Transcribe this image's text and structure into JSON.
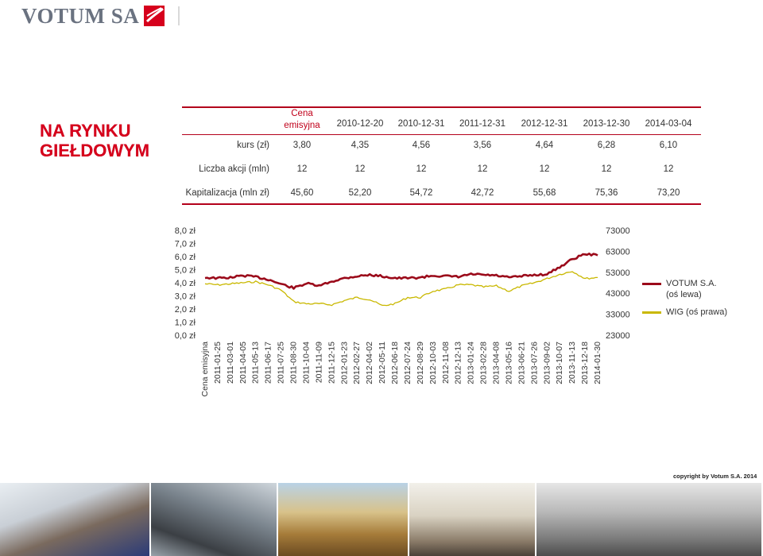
{
  "brand": {
    "name": "VOTUM SA"
  },
  "section_title": [
    "NA RYNKU",
    "GIEŁDOWYM"
  ],
  "table": {
    "first_header": "Cena emisyjna",
    "dates": [
      "2010-12-20",
      "2010-12-31",
      "2011-12-31",
      "2012-12-31",
      "2013-12-30",
      "2014-03-04"
    ],
    "rows": [
      {
        "label": "kurs (zł)",
        "values": [
          "3,80",
          "4,35",
          "4,56",
          "3,56",
          "4,64",
          "6,28",
          "6,10"
        ]
      },
      {
        "label": "Liczba akcji (mln)",
        "values": [
          "12",
          "12",
          "12",
          "12",
          "12",
          "12",
          "12"
        ]
      },
      {
        "label": "Kapitalizacja (mln zł)",
        "values": [
          "45,60",
          "52,20",
          "54,72",
          "42,72",
          "55,68",
          "75,36",
          "73,20"
        ]
      }
    ]
  },
  "chart_data": {
    "type": "line",
    "x_categories": [
      "Cena emisyjna",
      "2011-01-25",
      "2011-03-01",
      "2011-04-05",
      "2011-05-13",
      "2011-06-17",
      "2011-07-25",
      "2011-08-30",
      "2011-10-04",
      "2011-11-09",
      "2011-12-15",
      "2012-01-23",
      "2012-02-27",
      "2012-04-02",
      "2012-05-11",
      "2012-06-18",
      "2012-07-24",
      "2012-08-29",
      "2012-10-03",
      "2012-11-08",
      "2012-12-13",
      "2013-01-24",
      "2013-02-28",
      "2013-04-08",
      "2013-05-16",
      "2013-06-21",
      "2013-07-26",
      "2013-09-02",
      "2013-10-07",
      "2013-11-13",
      "2013-12-18",
      "2014-01-30"
    ],
    "y_left_ticks": [
      "8,0 zł",
      "7,0 zł",
      "6,0 zł",
      "5,0 zł",
      "4,0 zł",
      "3,0 zł",
      "2,0 zł",
      "1,0 zł",
      "0,0 zł"
    ],
    "y_left_range": [
      0,
      8
    ],
    "y_right_ticks": [
      "73000",
      "63000",
      "53000",
      "43000",
      "33000",
      "23000"
    ],
    "y_right_range": [
      23000,
      73000
    ],
    "series": [
      {
        "name": "VOTUM S.A. (oś lewa)",
        "axis": "left",
        "color": "#9b0a1a",
        "values": [
          4.4,
          4.35,
          4.4,
          4.55,
          4.45,
          4.25,
          3.9,
          3.6,
          3.95,
          3.75,
          4.1,
          4.35,
          4.5,
          4.6,
          4.5,
          4.35,
          4.35,
          4.4,
          4.55,
          4.5,
          4.45,
          4.65,
          4.6,
          4.55,
          4.4,
          4.5,
          4.6,
          4.65,
          5.2,
          5.8,
          6.2,
          6.1
        ]
      },
      {
        "name": "WIG (oś prawa)",
        "axis": "right",
        "color": "#c9b800",
        "values": [
          47500,
          47000,
          47500,
          48000,
          48500,
          47000,
          44500,
          39000,
          38000,
          38000,
          37500,
          39500,
          41000,
          40000,
          37000,
          38000,
          41000,
          41000,
          44000,
          45000,
          47000,
          47000,
          46000,
          46500,
          44000,
          46500,
          48000,
          50000,
          52000,
          53500,
          50000,
          50500
        ]
      }
    ],
    "legend_position": "right"
  },
  "footer": {
    "copyright": "copyright by Votum S.A. 2014"
  },
  "photos": [
    "children-photo",
    "car-accident-photo",
    "harvest-photo",
    "construction-worker-photo",
    "damaged-building-photo"
  ]
}
